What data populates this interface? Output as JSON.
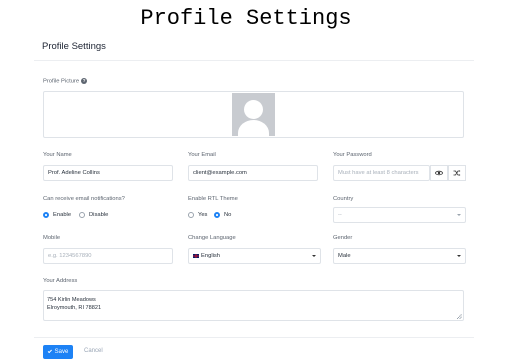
{
  "banner": {
    "title": "Profile Settings"
  },
  "card": {
    "title": "Profile Settings"
  },
  "profile_picture": {
    "label": "Profile Picture",
    "help_icon": "question-circle-icon",
    "avatar_icon": "default-avatar-icon"
  },
  "fields": {
    "name": {
      "label": "Your Name",
      "value": "Prof. Adeline Collins"
    },
    "email": {
      "label": "Your Email",
      "value": "client@example.com"
    },
    "password": {
      "label": "Your Password",
      "placeholder": "Must have at least 8 characters",
      "show_icon": "eye-icon",
      "generate_icon": "shuffle-icon"
    },
    "email_notifications": {
      "label": "Can receive email notifications?",
      "options": [
        "Enable",
        "Disable"
      ],
      "selected": "Enable"
    },
    "rtl": {
      "label": "Enable RTL Theme",
      "options": [
        "Yes",
        "No"
      ],
      "selected": "No"
    },
    "country": {
      "label": "Country",
      "value": "--"
    },
    "mobile": {
      "label": "Mobile",
      "placeholder": "e.g. 1234567890"
    },
    "language": {
      "label": "Change Language",
      "value": "English",
      "flag_icon": "uk-flag-icon"
    },
    "gender": {
      "label": "Gender",
      "value": "Male"
    },
    "address": {
      "label": "Your Address",
      "line1": "754 Kirlin Meadows",
      "line2": "Elroymouth, RI 78821"
    }
  },
  "actions": {
    "save_label": "Save",
    "cancel_label": "Cancel"
  },
  "colors": {
    "primary": "#1d82f5",
    "border": "#dfe3e8",
    "label": "#5d6570",
    "avatar_bg": "#c8cbd0"
  }
}
